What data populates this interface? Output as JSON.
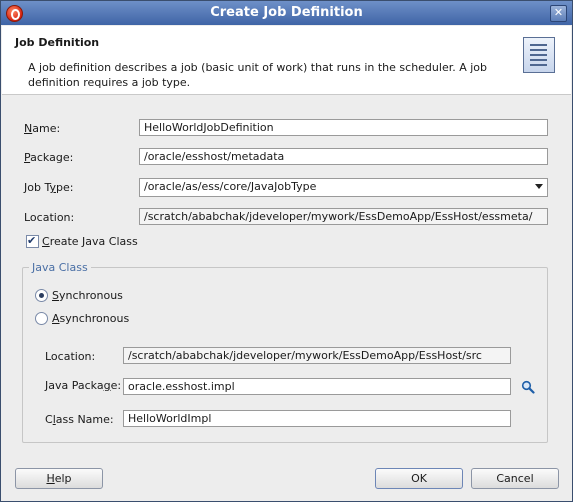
{
  "window": {
    "title": "Create Job Definition"
  },
  "header": {
    "title": "Job Definition",
    "description": "A job definition describes a job (basic unit of work) that runs in the scheduler.  A job definition requires a job type."
  },
  "form": {
    "name": {
      "label_first": "N",
      "label_rest": "ame:",
      "value": "HelloWorldJobDefinition"
    },
    "package": {
      "label_first": "P",
      "label_rest": "ackage:",
      "value": "/oracle/esshost/metadata"
    },
    "job_type": {
      "label_pre": "Job T",
      "label_mnemonic": "y",
      "label_post": "pe:",
      "value": "/oracle/as/ess/core/JavaJobType"
    },
    "location": {
      "label": "Location:",
      "value": "/scratch/ababchak/jdeveloper/mywork/EssDemoApp/EssHost/essmeta/"
    },
    "create_java_class": {
      "label_first": "C",
      "label_rest": "reate Java Class",
      "checked": true
    }
  },
  "java_class": {
    "legend": "Java Class",
    "synchronous": {
      "label_first": "S",
      "label_rest": "ynchronous",
      "selected": true
    },
    "asynchronous": {
      "label_first": "A",
      "label_rest": "synchronous",
      "selected": false
    },
    "location": {
      "label": "Location:",
      "value": "/scratch/ababchak/jdeveloper/mywork/EssDemoApp/EssHost/src"
    },
    "java_package": {
      "label_pre": "Java Packa",
      "label_mnemonic": "g",
      "label_post": "e:",
      "value": "oracle.esshost.impl"
    },
    "class_name": {
      "label_pre": "C",
      "label_mnemonic": "l",
      "label_post": "ass Name:",
      "value": "HelloWorldImpl"
    }
  },
  "buttons": {
    "help": {
      "mnemonic": "H",
      "rest": "elp"
    },
    "ok": "OK",
    "cancel": "Cancel"
  },
  "icons": {
    "app": "oracle-icon",
    "close": "close-icon",
    "header": "document-list-icon",
    "browse": "magnifier-icon"
  }
}
